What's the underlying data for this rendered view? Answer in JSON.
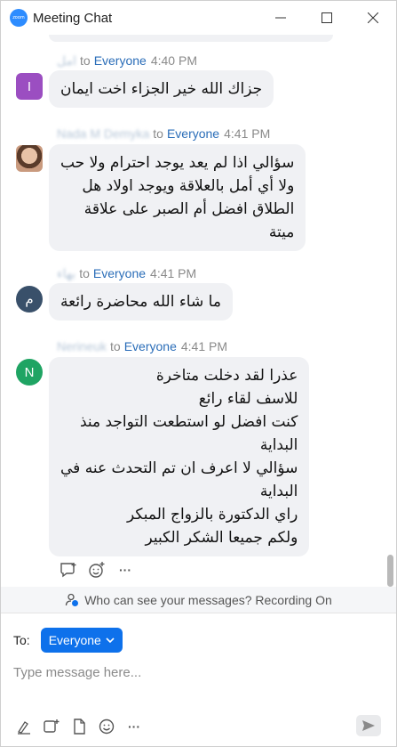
{
  "window": {
    "title": "Meeting Chat",
    "logo_text": "zoom",
    "buttons": [
      "minimize",
      "maximize",
      "close"
    ]
  },
  "messages": [
    {
      "sender": "امل",
      "to": "to",
      "recipient": "Everyone",
      "time": "4:40 PM",
      "avatar_letter": "I",
      "avatar_color": "#9b4ec1",
      "lines": [
        "جزاك الله خير الجزاء اخت ايمان"
      ]
    },
    {
      "sender": "Nada M Demyka",
      "to": "to",
      "recipient": "Everyone",
      "time": "4:41 PM",
      "avatar_letter": "",
      "avatar_color": "photo",
      "lines": [
        "سؤالي اذا لم يعد يوجد احترام ولا حب",
        "ولا أي أمل بالعلاقة ويوجد اولاد هل",
        "الطلاق افضل أم الصبر على علاقة",
        "ميتة"
      ]
    },
    {
      "sender": "بهاء",
      "to": "to",
      "recipient": "Everyone",
      "time": "4:41 PM",
      "avatar_letter": "م",
      "avatar_color": "#39506a",
      "lines": [
        "ما شاء الله محاضرة رائعة"
      ]
    },
    {
      "sender": "Nerineuk",
      "to": "to",
      "recipient": "Everyone",
      "time": "4:41 PM",
      "avatar_letter": "N",
      "avatar_color": "#1fa463",
      "lines": [
        "عذرا لقد دخلت متاخرة",
        "للاسف لقاء رائع",
        "كنت افضل لو استطعت التواجد منذ",
        "البداية",
        "سؤالي لا اعرف ان تم التحدث عنه في",
        "البداية",
        "راي الدكتورة بالزواج المبكر",
        "ولكم جميعا الشكر الكبير"
      ]
    }
  ],
  "reaction_bar": {
    "icons": [
      "reply-icon",
      "emoji-react-icon",
      "more-icon"
    ],
    "more_label": "···"
  },
  "notice": {
    "text": "Who can see your messages? Recording On",
    "icon": "person-privacy-icon"
  },
  "composer": {
    "to_label": "To:",
    "recipient_selected": "Everyone",
    "placeholder": "Type message here...",
    "value": "",
    "toolbar_icons": [
      "format-icon",
      "screenshot-icon",
      "file-icon",
      "emoji-icon",
      "more-icon"
    ],
    "more_label": "···",
    "send_icon": "send-icon"
  },
  "colors": {
    "accent": "#0e71eb",
    "recipient_link": "#2a6db8",
    "bubble_bg": "#f0f1f4"
  }
}
